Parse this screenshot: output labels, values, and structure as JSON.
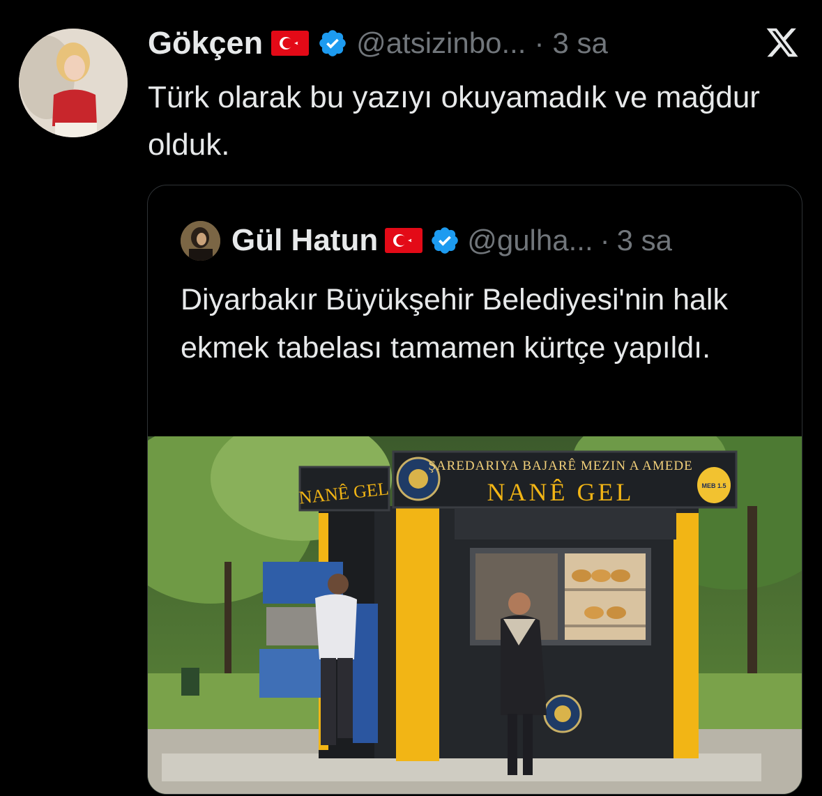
{
  "tweet": {
    "author_name": "Gökçen",
    "handle": "@atsizinbo...",
    "separator": "·",
    "time": "3 sa",
    "text": "Türk olarak bu yazıyı okuyamadık ve mağdur olduk.",
    "flag": "turkey-flag-icon",
    "verified": "verified-badge-icon"
  },
  "brand": {
    "icon": "x-logo-icon"
  },
  "quoted_tweet": {
    "author_name": "Gül Hatun",
    "handle": "@gulha...",
    "separator": "·",
    "time": "3 sa",
    "text": "Diyarbakır Büyükşehir Belediyesi'nin halk ekmek tabelası tamamen kürtçe yapıldı.",
    "flag": "turkey-flag-icon",
    "verified": "verified-badge-icon",
    "media": {
      "sign_top": "ŞAREDARIYA BAJARÊ MEZIN A AMEDE",
      "sign_main": "NANÊ GEL",
      "sign_side": "NANÊ GEL",
      "logo_text": "MEB 1.5"
    }
  },
  "colors": {
    "background": "#000000",
    "text": "#e7e9ea",
    "secondary_text": "#71767b",
    "verified_blue": "#1d9bf0",
    "kiosk_yellow": "#f2b515"
  }
}
